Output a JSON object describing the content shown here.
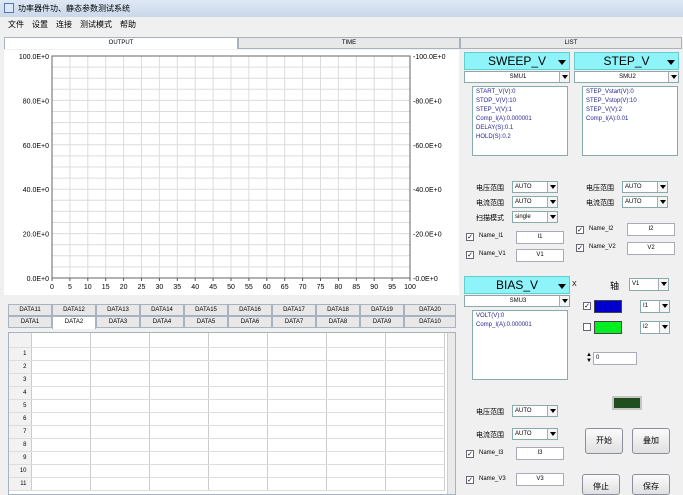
{
  "window": {
    "title": "功率器件功、静态参数测试系统"
  },
  "menu": [
    "文件",
    "设置",
    "连接",
    "测试模式",
    "帮助"
  ],
  "top_tabs": {
    "output": "OUTPUT",
    "time": "TIME",
    "list": "LIST"
  },
  "chart_data": {
    "type": "line",
    "x_ticks": [
      "0",
      "5",
      "10",
      "15",
      "20",
      "25",
      "30",
      "35",
      "40",
      "45",
      "50",
      "55",
      "60",
      "65",
      "70",
      "75",
      "80",
      "85",
      "90",
      "95",
      "100"
    ],
    "y_left_ticks": [
      "100.0E+0",
      "80.0E+0",
      "60.0E+0",
      "40.0E+0",
      "20.0E+0",
      "0.0E+0"
    ],
    "y_right_ticks": [
      "100.0E+0",
      "80.0E+0",
      "60.0E+0",
      "40.0E+0",
      "20.0E+0",
      "0.0E+0"
    ],
    "x_range": [
      0,
      100
    ],
    "y_range": [
      0,
      100
    ],
    "grid": true,
    "series": []
  },
  "data_tabs": {
    "row1": [
      "DATA11",
      "DATA12",
      "DATA13",
      "DATA14",
      "DATA15",
      "DATA16",
      "DATA17",
      "DATA18",
      "DATA19",
      "DATA20"
    ],
    "row2": [
      "DATA1",
      "DATA2",
      "DATA3",
      "DATA4",
      "DATA5",
      "DATA6",
      "DATA7",
      "DATA8",
      "DATA9",
      "DATA10"
    ]
  },
  "table_rows": [
    "1",
    "2",
    "3",
    "4",
    "5",
    "6",
    "7",
    "8",
    "9",
    "10",
    "11"
  ],
  "sweep": {
    "title": "SWEEP_V",
    "smu": "SMU1",
    "params": [
      "START_V(V):0",
      "STOP_V(V):10",
      "STEP_V(V):1",
      "Comp_I(A):0.000001",
      "DELAY(S):0.1",
      "HOLD(S):0.2"
    ],
    "volt_range_label": "电压范围",
    "volt_range": "AUTO",
    "curr_range_label": "电流范围",
    "curr_range": "AUTO",
    "mode_label": "扫描模式",
    "mode": "single",
    "name_i_label": "Name_I1",
    "name_i": "I1",
    "name_v_label": "Name_V1",
    "name_v": "V1"
  },
  "step": {
    "title": "STEP_V",
    "smu": "SMU2",
    "params": [
      "STEP_Vstart(V):0",
      "STEP_Vstop(V):10",
      "STEP_V(V):2",
      "Comp_I(A):0.01"
    ],
    "volt_range_label": "电压范围",
    "volt_range": "AUTO",
    "curr_range_label": "电流范围",
    "curr_range": "AUTO",
    "name_i_label": "Name_I2",
    "name_i": "I2",
    "name_v_label": "Name_V2",
    "name_v": "V2"
  },
  "bias": {
    "title": "BIAS_V",
    "smu": "SMU3",
    "params": [
      "VOLT(V):0",
      "Comp_I(A):0.000001"
    ],
    "volt_range_label": "电压范围",
    "volt_range": "AUTO",
    "curr_range_label": "电流范围",
    "curr_range": "AUTO",
    "name_i_label": "Name_I3",
    "name_i": "I3",
    "name_v_label": "Name_V3",
    "name_v": "V3"
  },
  "axis": {
    "x_label": "X",
    "axis_label": "轴",
    "x_value": "V1",
    "y1_value": "I1",
    "y2_value": "I2",
    "color1": "#0000cc",
    "color2": "#00ee22",
    "spin_value": "0"
  },
  "buttons": {
    "start": "开始",
    "add": "叠加",
    "stop": "停止",
    "save": "保存"
  },
  "indicator_color": "#1f4f1f"
}
